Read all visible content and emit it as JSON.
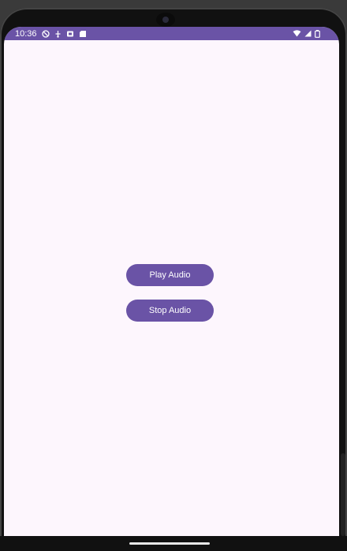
{
  "status_bar": {
    "time": "10:36",
    "left_icons": [
      "do-not-disturb-icon",
      "usb-icon",
      "notification-icon",
      "sd-card-icon"
    ],
    "right_icons": [
      "wifi-icon",
      "signal-icon",
      "battery-icon"
    ],
    "color": "#6a53a6"
  },
  "main": {
    "play_button_label": "Play Audio",
    "stop_button_label": "Stop Audio",
    "background_color": "#fdf6fd",
    "button_color": "#6a53a6"
  }
}
